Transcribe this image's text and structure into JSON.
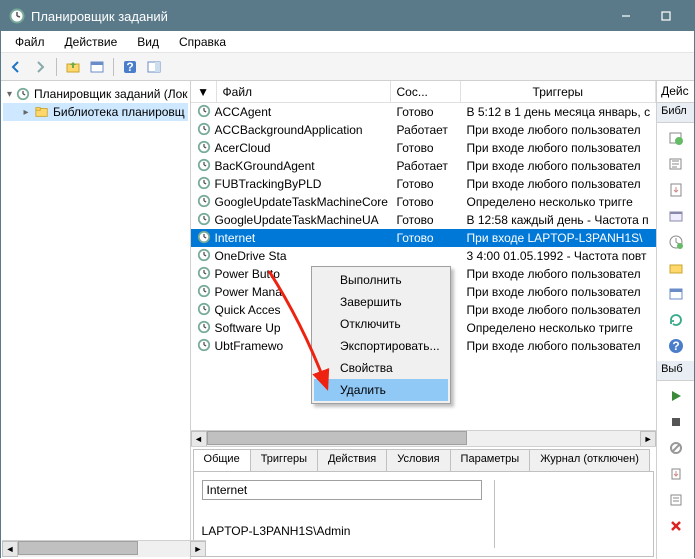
{
  "window": {
    "title": "Планировщик заданий"
  },
  "menu": {
    "file": "Файл",
    "action": "Действие",
    "view": "Вид",
    "help": "Справка"
  },
  "tree": {
    "root": "Планировщик заданий (Лок",
    "lib": "Библиотека планировщ"
  },
  "grid": {
    "head_sort": "▼",
    "head_file": "Файл",
    "head_status": "Сос...",
    "head_triggers": "Триггеры",
    "rows": [
      {
        "name": "ACCAgent",
        "status": "Готово",
        "trigger": "В 5:12 в 1 день месяца январь, с"
      },
      {
        "name": "ACCBackgroundApplication",
        "status": "Работает",
        "trigger": "При входе любого пользовател"
      },
      {
        "name": "AcerCloud",
        "status": "Готово",
        "trigger": "При входе любого пользовател"
      },
      {
        "name": "BacKGroundAgent",
        "status": "Работает",
        "trigger": "При входе любого пользовател"
      },
      {
        "name": "FUBTrackingByPLD",
        "status": "Готово",
        "trigger": "При входе любого пользовател"
      },
      {
        "name": "GoogleUpdateTaskMachineCore",
        "status": "Готово",
        "trigger": "Определено несколько тригге"
      },
      {
        "name": "GoogleUpdateTaskMachineUA",
        "status": "Готово",
        "trigger": "В 12:58 каждый день - Частота п"
      },
      {
        "name": "Internet",
        "status": "Готово",
        "trigger": "При входе LAPTOP-L3PANH1S\\",
        "sel": true
      },
      {
        "name": "OneDrive Sta",
        "status": "",
        "trigger": "3 4:00 01.05.1992 - Частота повт"
      },
      {
        "name": "Power Butto",
        "status": "",
        "trigger": "При входе любого пользовател"
      },
      {
        "name": "Power Mana",
        "status": "",
        "trigger": "При входе любого пользовател"
      },
      {
        "name": "Quick Acces",
        "status": "",
        "trigger": "При входе любого пользовател"
      },
      {
        "name": "Software Up",
        "status": "",
        "trigger": "Определено несколько тригге"
      },
      {
        "name": "UbtFramewo",
        "status": "",
        "trigger": "При входе любого пользовател"
      }
    ]
  },
  "context": {
    "run": "Выполнить",
    "end": "Завершить",
    "disable": "Отключить",
    "export": "Экспортировать...",
    "properties": "Свойства",
    "delete": "Удалить"
  },
  "tabs": {
    "general": "Общие",
    "triggers": "Триггеры",
    "actions": "Действия",
    "conditions": "Условия",
    "settings": "Параметры",
    "history": "Журнал (отключен)"
  },
  "details": {
    "name_value": "Internet",
    "path": "LAPTOP-L3PANH1S\\Admin"
  },
  "right": {
    "header": "Дейс",
    "sub1": "Библ",
    "sub2": "Выб"
  }
}
